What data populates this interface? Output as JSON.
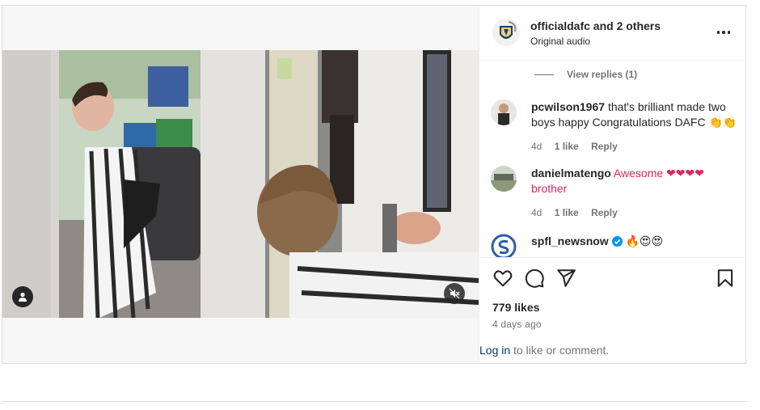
{
  "post": {
    "author": "officialdafc",
    "others": "and 2 others",
    "audio": "Original audio",
    "view_replies": "View replies (1)",
    "comments": [
      {
        "user": "pcwilson1967",
        "text": "that's brilliant made two boys happy Congratulations DAFC 👏👏",
        "age": "4d",
        "likes": "1 like",
        "reply": "Reply"
      },
      {
        "user": "danielmatengo",
        "text": "Awesome ❤❤❤❤ brother",
        "age": "4d",
        "likes": "1 like",
        "reply": "Reply"
      },
      {
        "user": "spfl_newsnow",
        "text": "🔥😍😍",
        "verified": true
      }
    ],
    "likes": "779 likes",
    "posted": "4 days ago",
    "login_link": "Log in",
    "login_suffix": " to like or comment."
  },
  "icons": {
    "like": "heart-icon",
    "comment": "comment-icon",
    "share": "share-icon",
    "save": "bookmark-icon",
    "more": "more-icon",
    "mute": "muted-speaker-icon",
    "user_tag": "user-tag-icon"
  },
  "colors": {
    "link": "#00376b",
    "muted": "#737373",
    "border": "#dbdbdb",
    "verified": "#0095f6"
  }
}
